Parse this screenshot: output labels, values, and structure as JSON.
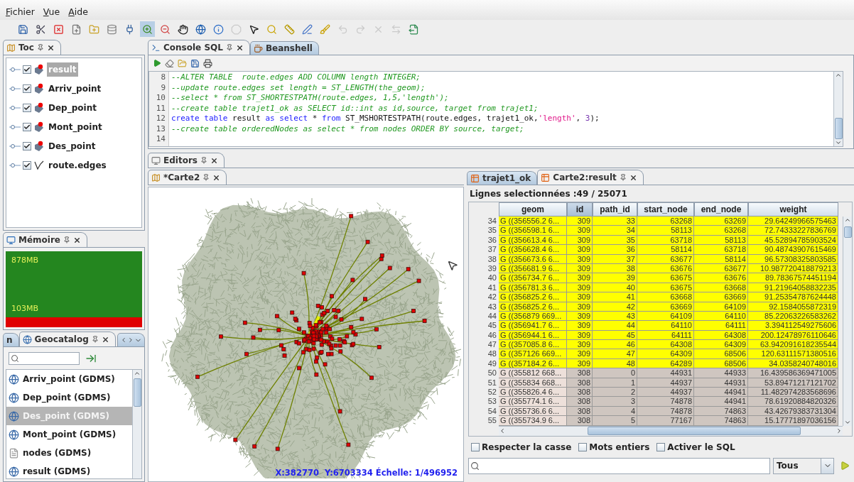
{
  "menu": [
    {
      "label": "Fichier"
    },
    {
      "label": "Vue"
    },
    {
      "label": "Aide"
    }
  ],
  "toolbar": [
    {
      "selected": false,
      "disabled": false
    },
    {
      "selected": false,
      "disabled": false
    },
    {
      "selected": false,
      "disabled": false
    },
    {
      "selected": false,
      "disabled": false
    },
    {
      "selected": false,
      "disabled": false
    },
    {
      "selected": false,
      "disabled": false
    },
    {
      "selected": false,
      "disabled": false
    },
    {
      "selected": true,
      "disabled": false
    },
    {
      "selected": false,
      "disabled": false
    },
    {
      "selected": false,
      "disabled": false
    },
    {
      "selected": false,
      "disabled": false
    },
    {
      "selected": false,
      "disabled": false
    },
    {
      "selected": false,
      "disabled": true
    },
    {
      "selected": false,
      "disabled": false
    },
    {
      "selected": false,
      "disabled": false
    },
    {
      "selected": false,
      "disabled": false
    },
    {
      "selected": false,
      "disabled": false
    },
    {
      "selected": false,
      "disabled": false
    },
    {
      "selected": false,
      "disabled": true
    },
    {
      "selected": false,
      "disabled": true
    },
    {
      "selected": false,
      "disabled": true
    },
    {
      "selected": false,
      "disabled": true
    },
    {
      "selected": false,
      "disabled": false
    }
  ],
  "toc": {
    "tab": {
      "label": "Toc",
      "selected": true
    },
    "layers": [
      {
        "label": "result",
        "checked": true,
        "selected": true,
        "kind": "point"
      },
      {
        "label": "Arriv_point",
        "checked": true,
        "selected": false,
        "kind": "point"
      },
      {
        "label": "Dep_point",
        "checked": true,
        "selected": false,
        "kind": "point"
      },
      {
        "label": "Mont_point",
        "checked": true,
        "selected": false,
        "kind": "point"
      },
      {
        "label": "Des_point",
        "checked": true,
        "selected": false,
        "kind": "point"
      },
      {
        "label": "route.edges",
        "checked": true,
        "selected": false,
        "kind": "line"
      }
    ]
  },
  "memory": {
    "tab": {
      "label": "Mémoire",
      "selected": true
    },
    "total": "878MB",
    "used": "103MB"
  },
  "geocatalog": {
    "tabs": [
      {
        "label": "n",
        "selected": false
      },
      {
        "label": "Geocatalog",
        "selected": true
      }
    ],
    "items": [
      {
        "label": "Arriv_point (GDMS)",
        "selected": false,
        "kind": "layer"
      },
      {
        "label": "Dep_point (GDMS)",
        "selected": false,
        "kind": "layer"
      },
      {
        "label": "Des_point (GDMS)",
        "selected": true,
        "kind": "layer"
      },
      {
        "label": "Mont_point (GDMS)",
        "selected": false,
        "kind": "layer"
      },
      {
        "label": "nodes (GDMS)",
        "selected": false,
        "kind": "table"
      },
      {
        "label": "result (GDMS)",
        "selected": false,
        "kind": "layer"
      }
    ]
  },
  "console": {
    "tabs": [
      {
        "label": "Console SQL",
        "selected": true
      },
      {
        "label": "Beanshell",
        "selected": false
      }
    ],
    "lines": [
      {
        "number": "8",
        "tokens": [
          {
            "kind": "comment",
            "text": "--ALTER TABLE  route.edges ADD COLUMN length INTEGER;"
          }
        ]
      },
      {
        "number": "9",
        "tokens": [
          {
            "kind": "comment",
            "text": "--update route.edges set length = ST_LENGTH(the_geom);"
          }
        ]
      },
      {
        "number": "10",
        "tokens": [
          {
            "kind": "comment",
            "text": "--select * from ST_SHORTESTPATH(route.edges, 1,5,'length');"
          }
        ]
      },
      {
        "number": "11",
        "tokens": [
          {
            "kind": "comment",
            "text": "--create table trajet1_ok as SELECT id::int as id,source, target from trajet1;"
          }
        ]
      },
      {
        "number": "12",
        "tokens": [
          {
            "kind": "keyword",
            "text": "create table"
          },
          {
            "kind": "plain",
            "text": " result "
          },
          {
            "kind": "keyword",
            "text": "as select"
          },
          {
            "kind": "plain",
            "text": " * "
          },
          {
            "kind": "keyword",
            "text": "from"
          },
          {
            "kind": "plain",
            "text": " ST_MSHORTESTPATH(route.edges, trajet1_ok,"
          },
          {
            "kind": "string",
            "text": "'length'"
          },
          {
            "kind": "plain",
            "text": ", "
          },
          {
            "kind": "number",
            "text": "3"
          },
          {
            "kind": "plain",
            "text": ");"
          }
        ]
      },
      {
        "number": "13",
        "tokens": [
          {
            "kind": "comment",
            "text": "--create table orderedNodes as select * from nodes ORDER BY source, target;"
          }
        ]
      },
      {
        "number": "14"
      }
    ]
  },
  "editors": {
    "tab": {
      "label": "Editors",
      "selected": true
    },
    "map": {
      "tab": {
        "label": "*Carte2",
        "selected": true
      },
      "status": "X:382770  Y:6703334 Échelle: 1/496952"
    },
    "table_tabs": [
      {
        "label": "trajet1_ok",
        "selected": false
      },
      {
        "label": "Carte2:result",
        "selected": true
      }
    ],
    "selection": "Lignes selectionnées :49 / 25071",
    "columns": [
      {
        "label": "geom",
        "selected": false
      },
      {
        "label": "id",
        "selected": true
      },
      {
        "label": "path_id",
        "selected": false
      },
      {
        "label": "start_node",
        "selected": false
      },
      {
        "label": "end_node",
        "selected": false
      },
      {
        "label": "weight",
        "selected": false
      }
    ],
    "rows": [
      {
        "number": "34",
        "selected": true,
        "cells": [
          "G ((356556.2 6...",
          "309",
          "33",
          "63268",
          "63269",
          "29.64249966575463"
        ]
      },
      {
        "number": "35",
        "selected": true,
        "cells": [
          "G ((356598.1 6...",
          "309",
          "34",
          "58113",
          "63268",
          "72.74333227836769"
        ]
      },
      {
        "number": "36",
        "selected": true,
        "cells": [
          "G ((356613.4 6...",
          "309",
          "35",
          "63718",
          "58113",
          "45.52894785903524"
        ]
      },
      {
        "number": "37",
        "selected": true,
        "cells": [
          "G ((356628.4 6...",
          "309",
          "36",
          "58114",
          "63718",
          "90.48743907615469"
        ]
      },
      {
        "number": "38",
        "selected": true,
        "cells": [
          "G ((356673.6 6...",
          "309",
          "37",
          "63677",
          "58114",
          "96.57308325803585"
        ]
      },
      {
        "number": "39",
        "selected": true,
        "cells": [
          "G ((356681.9 6...",
          "309",
          "38",
          "63676",
          "63677",
          "10.987720418879213"
        ]
      },
      {
        "number": "40",
        "selected": true,
        "cells": [
          "G ((356734.7 6...",
          "309",
          "39",
          "63675",
          "63676",
          "89.78367574451194"
        ]
      },
      {
        "number": "41",
        "selected": true,
        "cells": [
          "G ((356781.3 6...",
          "309",
          "40",
          "63675",
          "63668",
          "91.21964058832235"
        ]
      },
      {
        "number": "42",
        "selected": true,
        "cells": [
          "G ((356825.2 6...",
          "309",
          "41",
          "63668",
          "63669",
          "91.25354787624448"
        ]
      },
      {
        "number": "43",
        "selected": true,
        "cells": [
          "G ((356825.2 6...",
          "309",
          "42",
          "63669",
          "64109",
          "92.1584055872319"
        ]
      },
      {
        "number": "44",
        "selected": true,
        "cells": [
          "G ((356879 669...",
          "309",
          "43",
          "64109",
          "64110",
          "85.22063226583262"
        ]
      },
      {
        "number": "45",
        "selected": true,
        "cells": [
          "G ((356941.7 6...",
          "309",
          "44",
          "64110",
          "64111",
          "3.394112549275606"
        ]
      },
      {
        "number": "46",
        "selected": true,
        "cells": [
          "G ((356944.1 6...",
          "309",
          "45",
          "64111",
          "64308",
          "200.12478976110646"
        ]
      },
      {
        "number": "47",
        "selected": true,
        "cells": [
          "G ((357085.8 6...",
          "309",
          "46",
          "64308",
          "64309",
          "63.942091618235544"
        ]
      },
      {
        "number": "48",
        "selected": true,
        "cells": [
          "G ((357126 669...",
          "309",
          "47",
          "64309",
          "68506",
          "120.63111571380516"
        ]
      },
      {
        "number": "49",
        "selected": true,
        "cells": [
          "G ((357184.2 6...",
          "309",
          "48",
          "64289",
          "68506",
          "34.0358240748016"
        ]
      },
      {
        "number": "50",
        "selected": false,
        "cells": [
          "G ((355812 668...",
          "308",
          "0",
          "44931",
          "44933",
          "16.439586369471005"
        ]
      },
      {
        "number": "51",
        "selected": false,
        "cells": [
          "G ((355834 668...",
          "308",
          "1",
          "44937",
          "44931",
          "53.89471217121702"
        ]
      },
      {
        "number": "52",
        "selected": false,
        "cells": [
          "G ((355826.4 6...",
          "308",
          "2",
          "44937",
          "44941",
          "11.482974283568696"
        ]
      },
      {
        "number": "53",
        "selected": false,
        "cells": [
          "G ((355774.1 6...",
          "308",
          "3",
          "74878",
          "44941",
          "78.61920884820326"
        ]
      },
      {
        "number": "54",
        "selected": false,
        "cells": [
          "G ((355736.6 6...",
          "308",
          "4",
          "74878",
          "74863",
          "43.42679383731304"
        ]
      },
      {
        "number": "55",
        "selected": false,
        "cells": [
          "G ((355734.9 6...",
          "308",
          "5",
          "77167",
          "74863",
          "15.17771897036156"
        ]
      }
    ],
    "options": [
      {
        "label": "Respecter la casse",
        "checked": false
      },
      {
        "label": "Mots entiers",
        "checked": false
      },
      {
        "label": "Activer le SQL",
        "checked": false
      }
    ],
    "filter": {
      "value": "Tous"
    }
  }
}
